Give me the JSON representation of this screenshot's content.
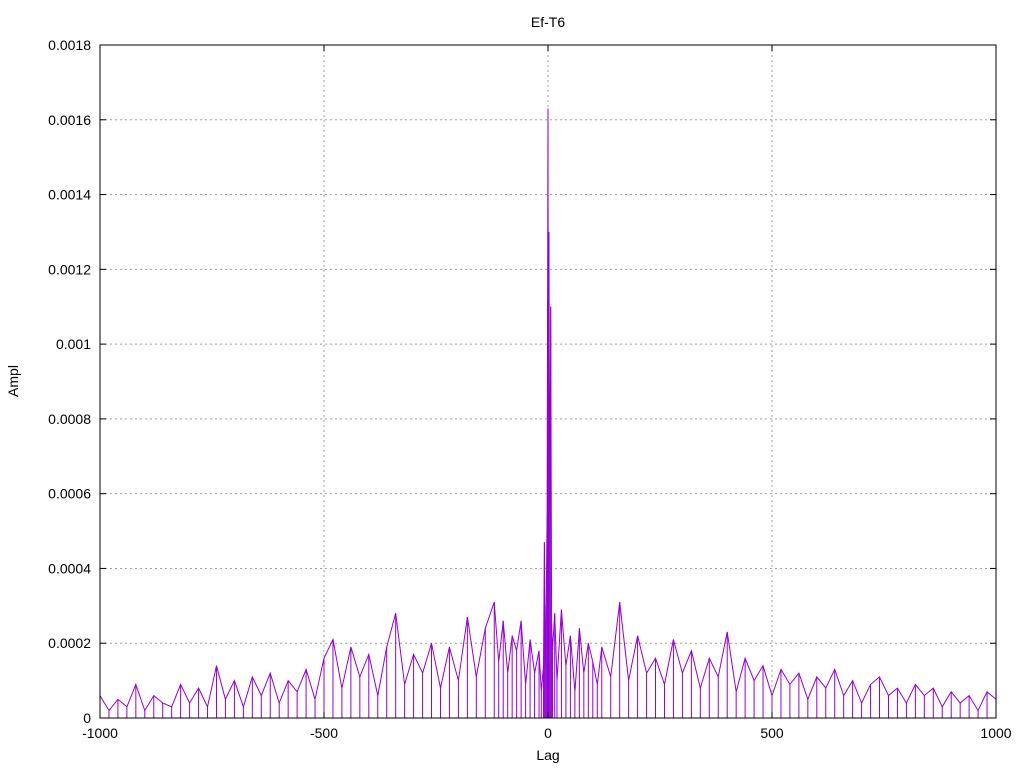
{
  "chart_data": {
    "type": "line",
    "title": "Ef-T6",
    "xlabel": "Lag",
    "ylabel": "Ampl",
    "xlim": [
      -1000,
      1000
    ],
    "ylim": [
      0,
      0.0018
    ],
    "x_ticks": [
      -1000,
      -500,
      0,
      500,
      1000
    ],
    "x_tick_labels": [
      "-1000",
      "-500",
      "0",
      "500",
      "1000"
    ],
    "y_ticks": [
      0,
      0.0002,
      0.0004,
      0.0006,
      0.0008,
      0.001,
      0.0012,
      0.0014,
      0.0016,
      0.0018
    ],
    "y_tick_labels": [
      "0",
      "0.0002",
      "0.0004",
      "0.0006",
      "0.0008",
      "0.001",
      "0.0012",
      "0.0014",
      "0.0016",
      "0.0018"
    ],
    "grid": true,
    "series_color": "#9400d3",
    "series": [
      {
        "x": [
          -1000,
          -980,
          -960,
          -940,
          -920,
          -900,
          -880,
          -860,
          -840,
          -820,
          -800,
          -780,
          -760,
          -740,
          -720,
          -700,
          -680,
          -660,
          -640,
          -620,
          -600,
          -580,
          -560,
          -540,
          -520,
          -500,
          -480,
          -460,
          -440,
          -420,
          -400,
          -380,
          -360,
          -340,
          -320,
          -300,
          -280,
          -260,
          -240,
          -220,
          -200,
          -180,
          -160,
          -140,
          -120,
          -110,
          -100,
          -90,
          -80,
          -70,
          -60,
          -50,
          -40,
          -30,
          -20,
          -15,
          -10,
          -8,
          -6,
          -4,
          -2,
          -1,
          0,
          1,
          2,
          4,
          6,
          8,
          10,
          15,
          20,
          30,
          40,
          50,
          60,
          70,
          80,
          90,
          100,
          110,
          120,
          140,
          160,
          180,
          200,
          220,
          240,
          260,
          280,
          300,
          320,
          340,
          360,
          380,
          400,
          420,
          440,
          460,
          480,
          500,
          520,
          540,
          560,
          580,
          600,
          620,
          640,
          660,
          680,
          700,
          720,
          740,
          760,
          780,
          800,
          820,
          840,
          860,
          880,
          900,
          920,
          940,
          960,
          980,
          1000
        ],
        "y": [
          6e-05,
          2e-05,
          5e-05,
          3e-05,
          9e-05,
          2e-05,
          6e-05,
          4e-05,
          3e-05,
          9e-05,
          4e-05,
          8e-05,
          3e-05,
          0.00014,
          5e-05,
          0.0001,
          3e-05,
          0.00011,
          6e-05,
          0.00012,
          4e-05,
          0.0001,
          7e-05,
          0.00013,
          5e-05,
          0.00016,
          0.00021,
          8e-05,
          0.00019,
          0.00011,
          0.00017,
          6e-05,
          0.00019,
          0.00028,
          9e-05,
          0.00017,
          0.00012,
          0.0002,
          8e-05,
          0.00019,
          0.0001,
          0.00027,
          0.00011,
          0.00024,
          0.00031,
          0.00015,
          0.00026,
          0.00012,
          0.00022,
          0.00018,
          0.00026,
          9e-05,
          0.00021,
          0.00012,
          0.00018,
          7e-05,
          0.00014,
          0.00047,
          0.00013,
          0.0003,
          0.00054,
          0.00112,
          0.00163,
          0.0006,
          0.0013,
          0.00045,
          0.0011,
          0.00025,
          0.00018,
          0.00028,
          0.0001,
          0.00029,
          0.00014,
          0.00022,
          7e-05,
          0.00024,
          0.00012,
          0.0002,
          0.00015,
          9e-05,
          0.00019,
          0.00011,
          0.00031,
          0.0001,
          0.00022,
          0.00012,
          0.00016,
          9e-05,
          0.00021,
          0.00012,
          0.00018,
          8e-05,
          0.00016,
          0.00011,
          0.00023,
          7e-05,
          0.00016,
          0.0001,
          0.00014,
          6e-05,
          0.00013,
          9e-05,
          0.00012,
          5e-05,
          0.00011,
          8e-05,
          0.00013,
          6e-05,
          0.0001,
          4e-05,
          9e-05,
          0.00011,
          6e-05,
          8e-05,
          4e-05,
          9e-05,
          6e-05,
          8e-05,
          3e-05,
          7e-05,
          4e-05,
          6e-05,
          2e-05,
          7e-05,
          5e-05
        ]
      }
    ]
  }
}
